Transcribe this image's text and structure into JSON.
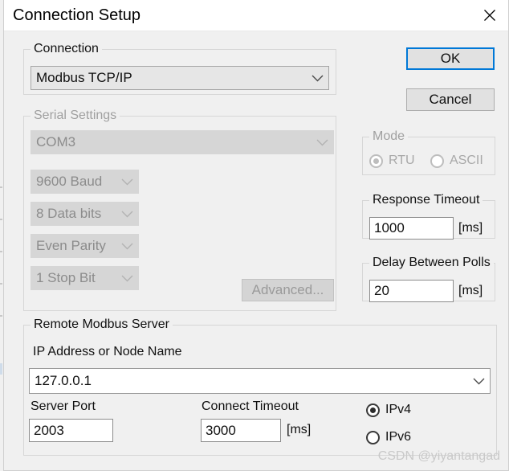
{
  "window": {
    "title": "Connection Setup",
    "close_icon": "close-icon",
    "accent_color": "#0078d7",
    "background_color": "#f0f0f0"
  },
  "buttons": {
    "ok": "OK",
    "cancel": "Cancel",
    "advanced": "Advanced..."
  },
  "connection": {
    "legend": "Connection",
    "value": "Modbus TCP/IP",
    "arrow_icon": "chevron-down-icon"
  },
  "serial_settings": {
    "legend": "Serial Settings",
    "enabled": false,
    "port": "COM3",
    "baud": "9600 Baud",
    "data_bits": "8 Data bits",
    "parity": "Even Parity",
    "stop_bits": "1 Stop Bit"
  },
  "mode": {
    "legend": "Mode",
    "enabled": false,
    "options": [
      {
        "label": "RTU",
        "checked": true
      },
      {
        "label": "ASCII",
        "checked": false
      }
    ]
  },
  "response_timeout": {
    "legend": "Response Timeout",
    "value": "1000",
    "unit": "[ms]"
  },
  "delay_between_polls": {
    "legend": "Delay Between Polls",
    "value": "20",
    "unit": "[ms]"
  },
  "remote_server": {
    "legend": "Remote Modbus Server",
    "ip_label": "IP Address or Node Name",
    "ip_value": "127.0.0.1",
    "server_port_label": "Server Port",
    "server_port_value": "2003",
    "connect_timeout_label": "Connect Timeout",
    "connect_timeout_value": "3000",
    "connect_timeout_unit": "[ms]",
    "ip_version": [
      {
        "label": "IPv4",
        "checked": true
      },
      {
        "label": "IPv6",
        "checked": false
      }
    ]
  },
  "watermark": "CSDN @yiyantangad"
}
